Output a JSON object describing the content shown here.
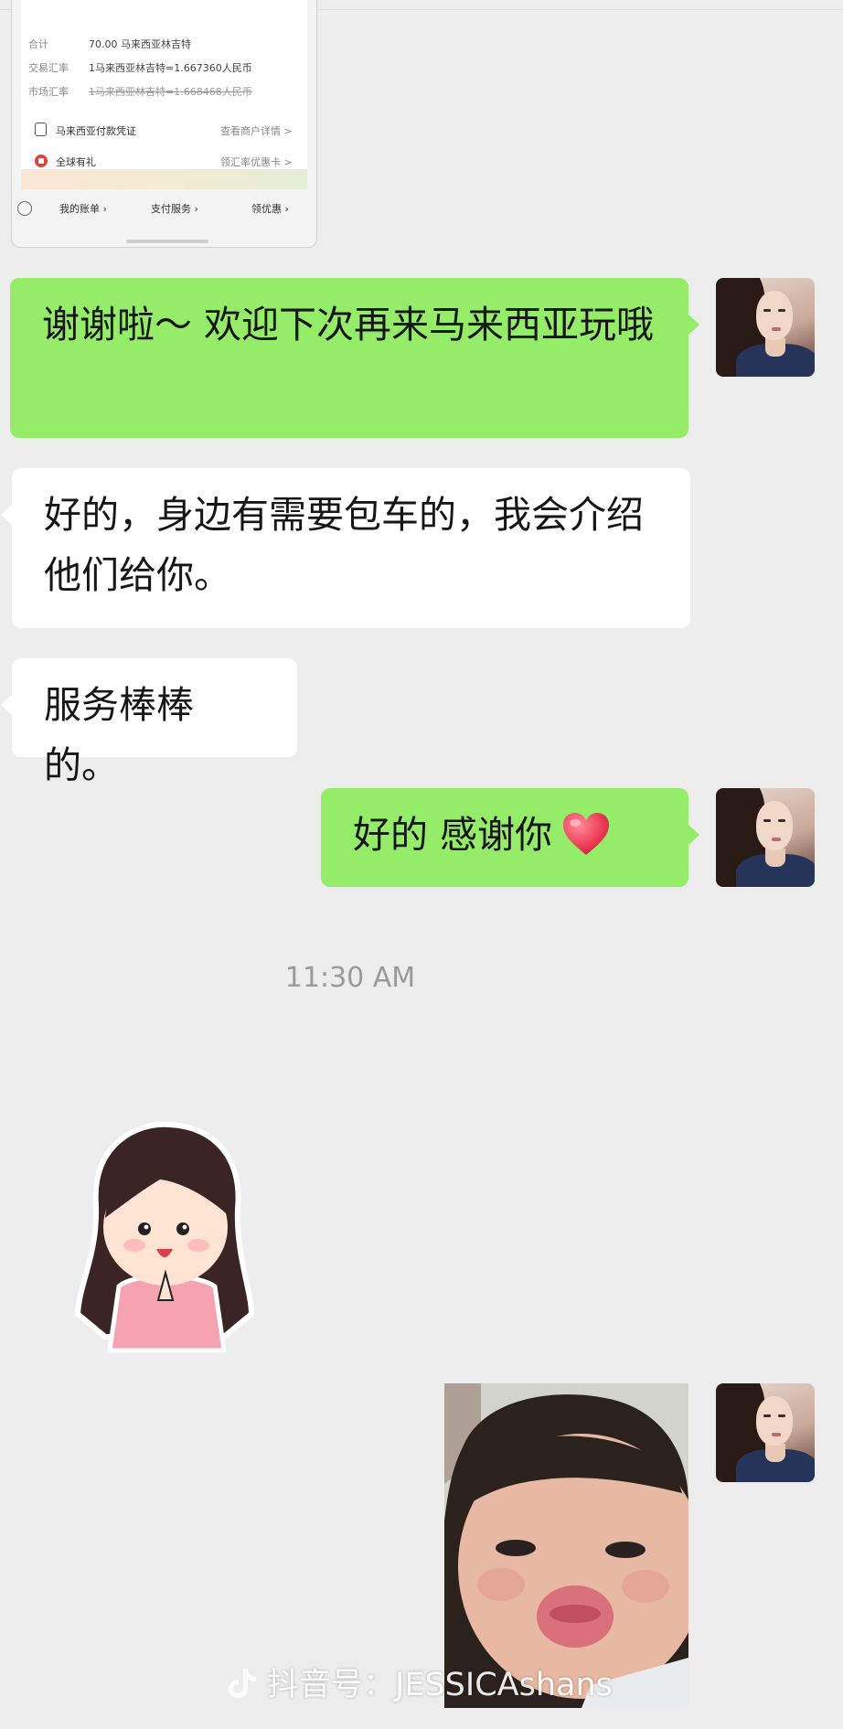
{
  "receipt": {
    "rows": [
      {
        "label": "合计",
        "value": "70.00 马来西亚林吉特"
      },
      {
        "label": "交易汇率",
        "value": "1马来西亚林吉特=1.667360人民币"
      },
      {
        "label": "市场汇率",
        "value": "1马来西亚林吉特=1.668468人民币"
      }
    ],
    "links": [
      {
        "label": "马来西亚付款凭证",
        "action": "查看商户详情 >"
      },
      {
        "label": "全球有礼",
        "action": "领汇率优惠卡 >"
      }
    ],
    "bottom_tabs": [
      "我的账单 ›",
      "支付服务 ›",
      "领优惠 ›"
    ]
  },
  "messages": {
    "m1": "谢谢啦～ 欢迎下次再来马来西亚玩哦",
    "m2": "好的，身边有需要包车的，我会介绍他们给你。",
    "m3": "服务棒棒的。",
    "m4": "好的 感谢你"
  },
  "timestamp": "11:30 AM",
  "watermark": {
    "prefix": "抖音号：",
    "handle": "JESSICAshans"
  },
  "colors": {
    "background": "#ededed",
    "sent_bubble": "#95ec69",
    "received_bubble": "#ffffff",
    "heart": "#f0445c"
  },
  "icons": [
    "heart-icon",
    "douyin-icon",
    "receipt-doc-icon",
    "gift-icon"
  ]
}
